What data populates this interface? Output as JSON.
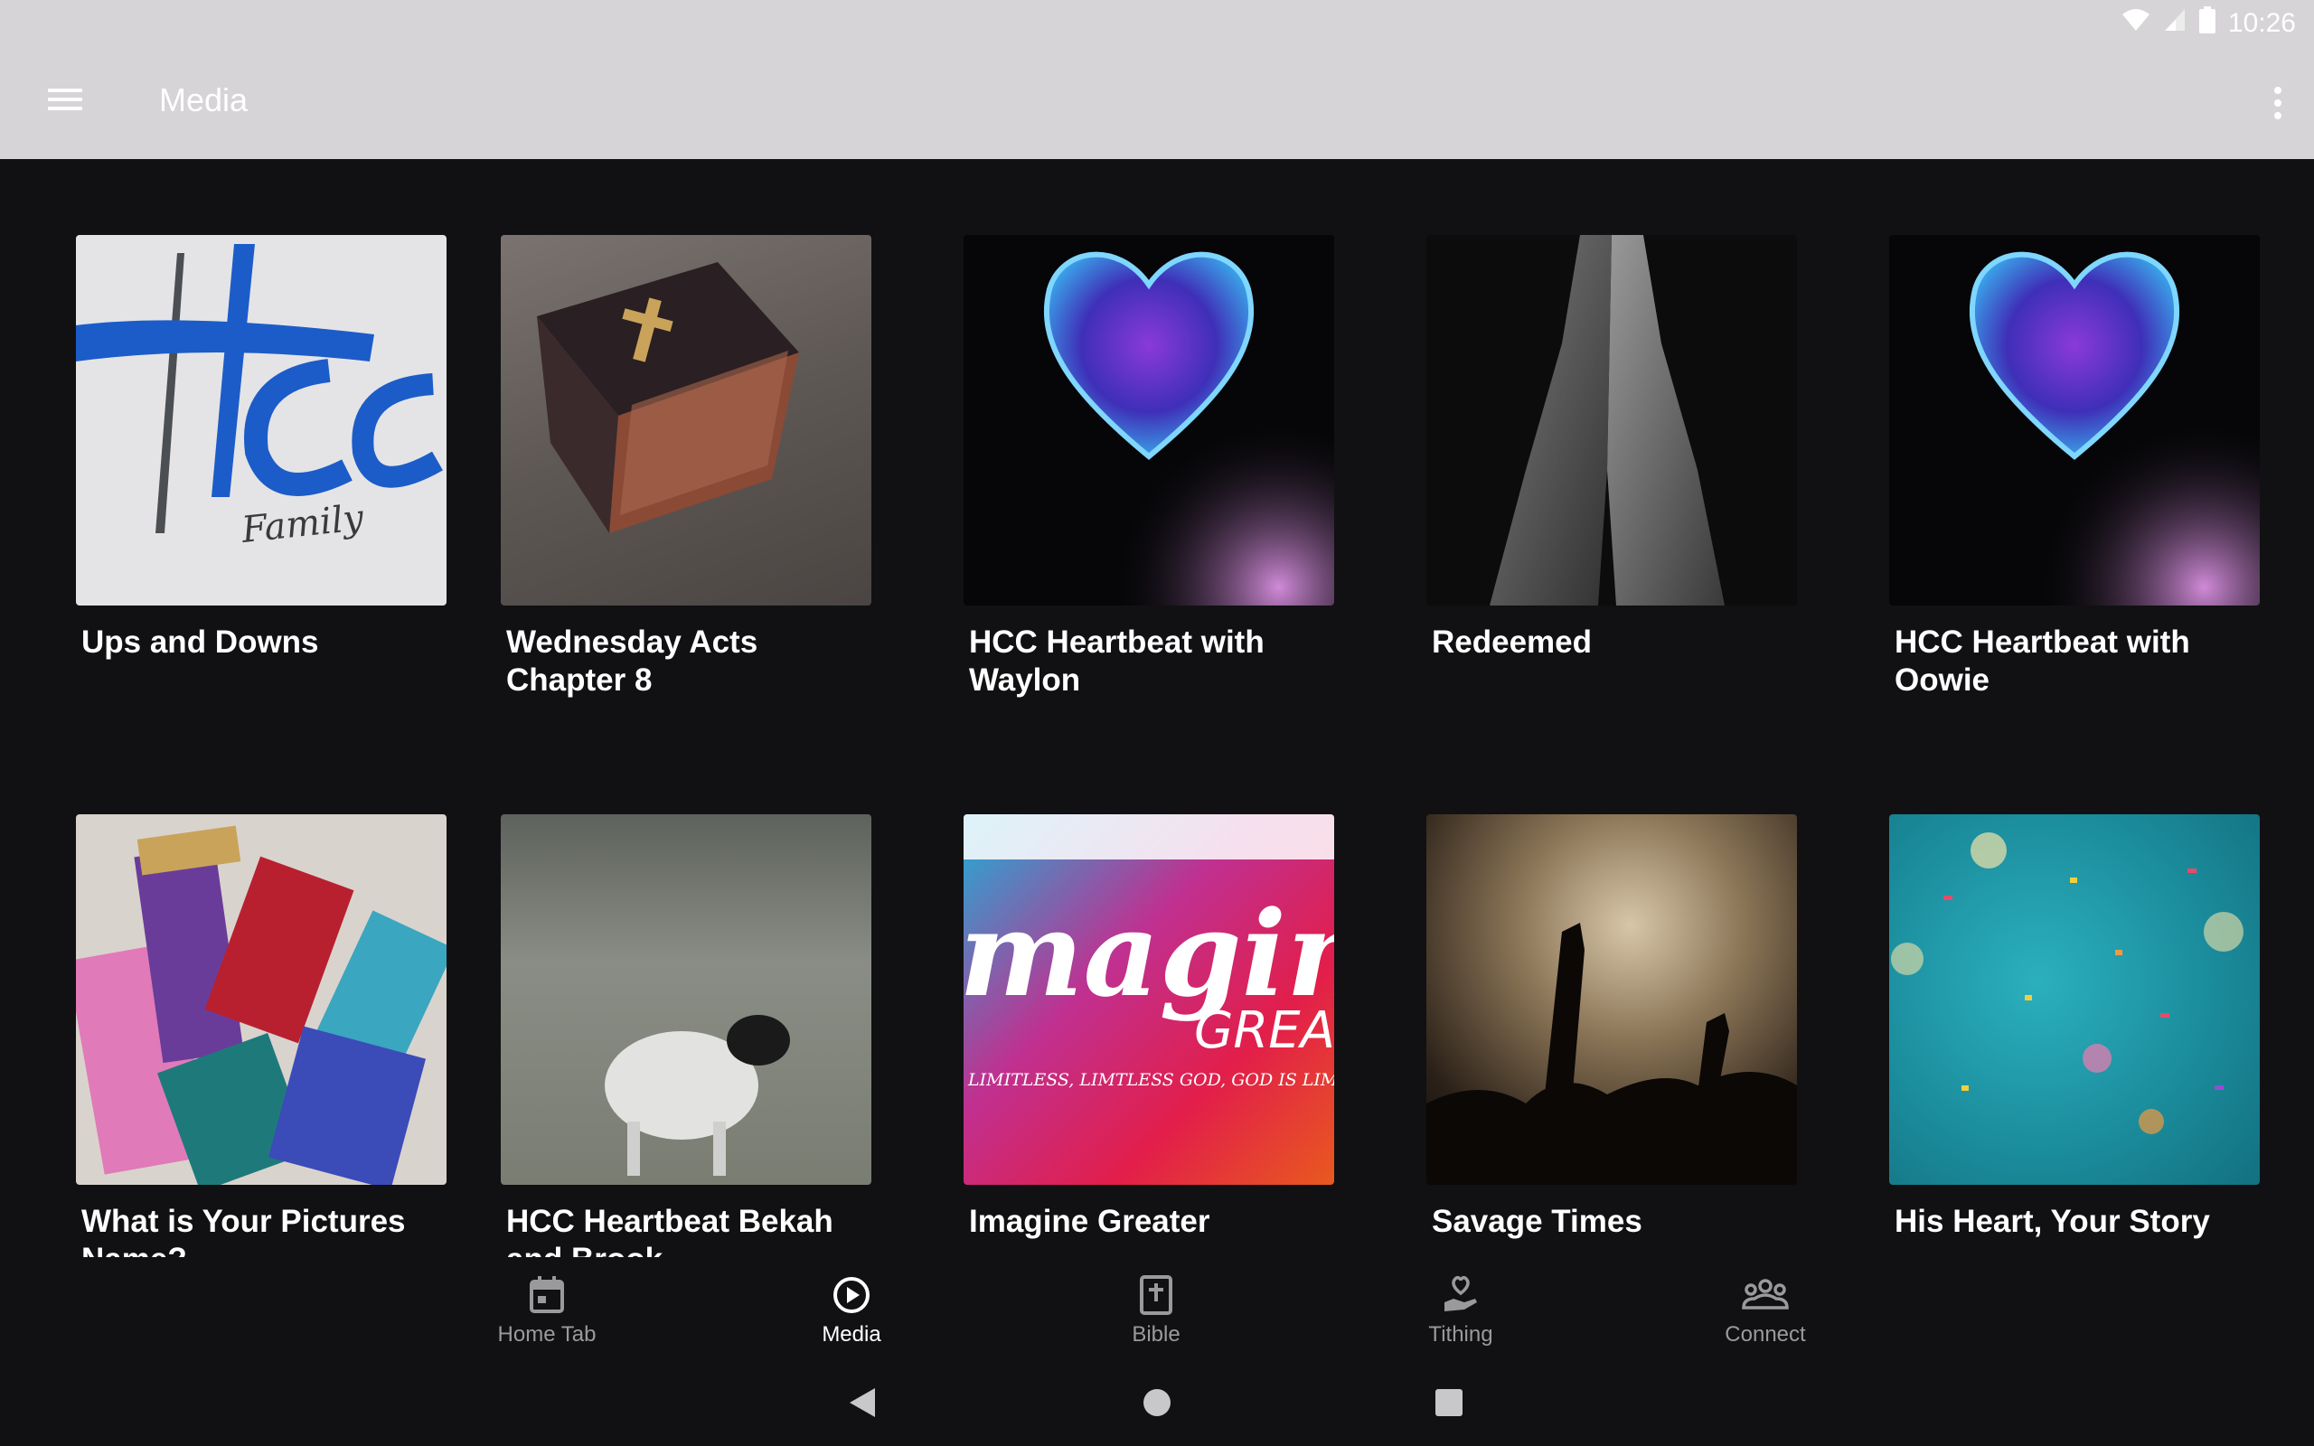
{
  "status_bar": {
    "time": "10:26"
  },
  "app_bar": {
    "title": "Media"
  },
  "media": [
    {
      "title": "Ups and Downs",
      "icon": "hcc-family-logo"
    },
    {
      "title": "Wednesday Acts Chapter 8",
      "icon": "bible-book"
    },
    {
      "title": "HCC Heartbeat with Waylon",
      "icon": "glass-heart"
    },
    {
      "title": "Redeemed",
      "icon": "praying-hands"
    },
    {
      "title": "HCC Heartbeat with Oowie",
      "icon": "glass-heart"
    },
    {
      "title": "What is Your Pictures Name?",
      "icon": "paint-brushes"
    },
    {
      "title": "HCC Heartbeat Bekah and Brook",
      "icon": "sheep-in-field"
    },
    {
      "title": "Imagine Greater",
      "icon": "colorful-smoke"
    },
    {
      "title": "Savage Times",
      "icon": "concert-crowd"
    },
    {
      "title": "His Heart, Your Story",
      "icon": "confetti"
    }
  ],
  "thumb_text": {
    "hcc_logo": "Hcc",
    "hcc_family": "Family",
    "imagine_word": "magin",
    "imagine_great": "GREA",
    "imagine_tagline": "LIMITLESS, LIMTLESS GOD, GOD IS LIM"
  },
  "bottom_nav": [
    {
      "label": "Home Tab",
      "icon": "calendar-icon"
    },
    {
      "label": "Media",
      "icon": "play-circle-icon",
      "active": true
    },
    {
      "label": "Bible",
      "icon": "bible-icon"
    },
    {
      "label": "Tithing",
      "icon": "give-hand-heart-icon"
    },
    {
      "label": "Connect",
      "icon": "group-icon"
    }
  ],
  "colors": {
    "app_bar": "#d6d4d6",
    "background": "#111113",
    "nav_inactive": "#9a9a9c",
    "nav_active": "#ffffff"
  }
}
